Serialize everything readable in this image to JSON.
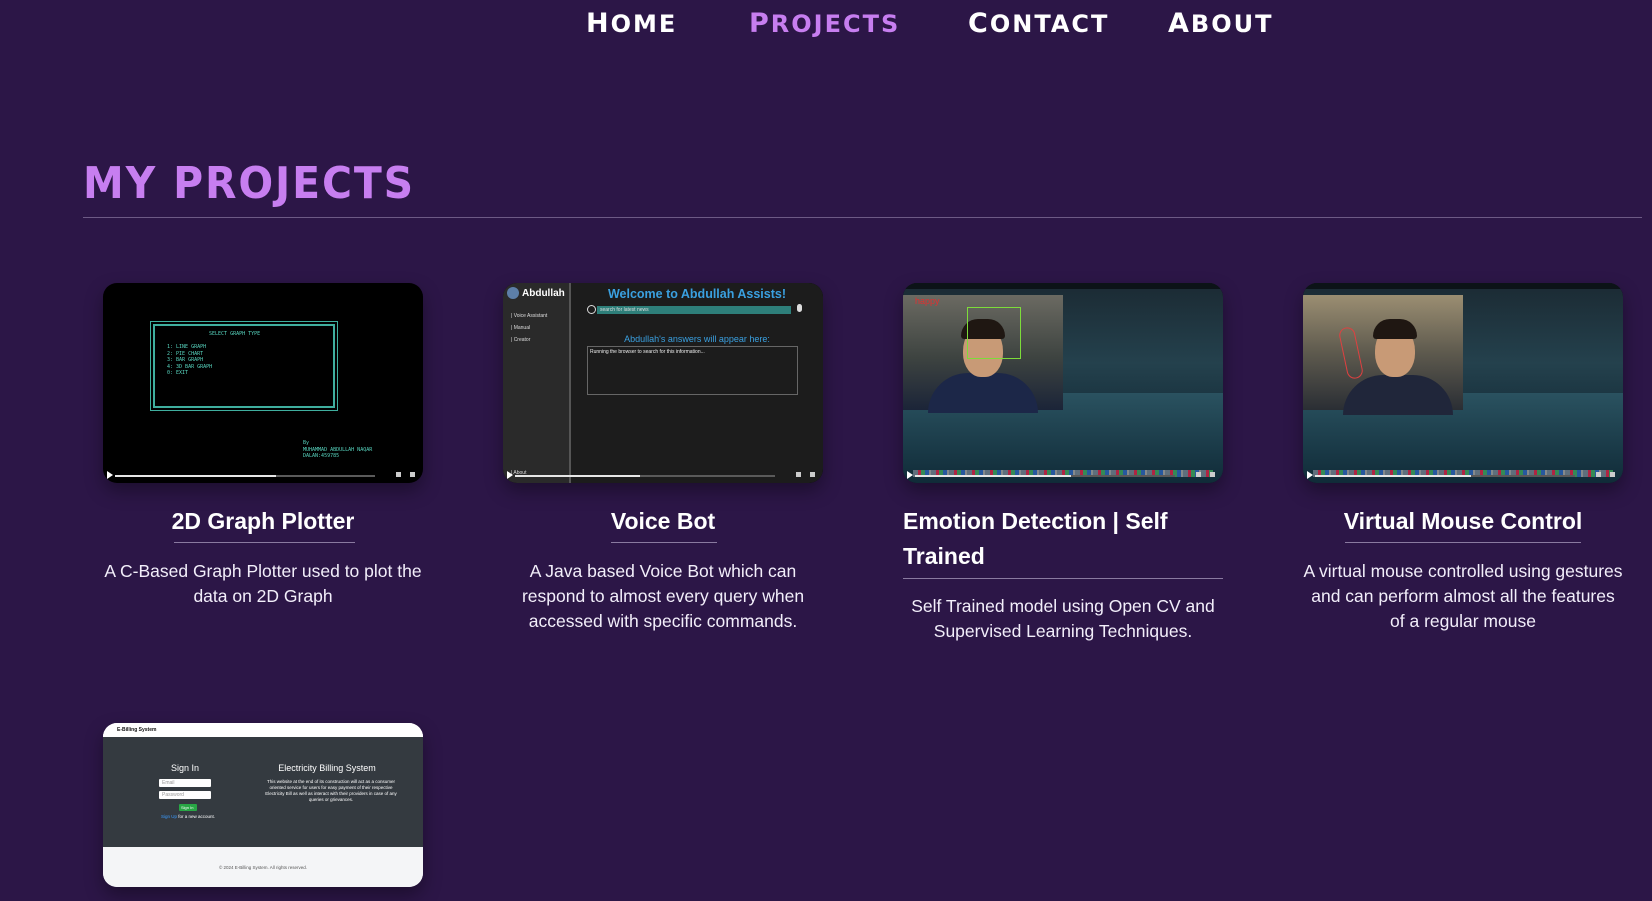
{
  "nav": {
    "items": [
      {
        "first": "H",
        "rest": "OME",
        "active": false
      },
      {
        "first": "P",
        "rest": "ROJECTS",
        "active": true
      },
      {
        "first": "C",
        "rest": "ONTACT",
        "active": false
      },
      {
        "first": "A",
        "rest": "BOUT",
        "active": false
      }
    ]
  },
  "page": {
    "title": "MY PROJECTS"
  },
  "projects": [
    {
      "title": "2D Graph Plotter",
      "description": "A C-Based Graph Plotter used to plot the data on 2D Graph",
      "thumb": {
        "heading": "SELECT GRAPH TYPE",
        "menu": "1: LINE GRAPH\n2: PIE CHART\n3: BAR GRAPH\n4: 3D BAR GRAPH\n0: EXIT",
        "credit": "By\nMUHAMMAD ABDULLAH NAQAR\nDALAN:459785",
        "progress": 0.62
      }
    },
    {
      "title": "Voice Bot",
      "description": "A Java based Voice Bot which can respond to almost every query when accessed with specific commands.",
      "thumb": {
        "brand": "Abdullah",
        "welcome": "Welcome to Abdullah Assists!",
        "search_value": "search for latest news",
        "answers_label": "Abdullah's answers will appear here:",
        "answer_text": "Running the browser to search for this information...",
        "menu": [
          "| Voice Assistant",
          "| Manual",
          "| Creator"
        ],
        "footer": "| About",
        "progress": 0.48
      }
    },
    {
      "title": "Emotion Detection | Self Trained",
      "description": "Self Trained model using Open CV and Supervised Learning Techniques.",
      "thumb": {
        "label": "happy",
        "progress": 0.6
      }
    },
    {
      "title": "Virtual Mouse Control",
      "description": "A virtual mouse controlled using gestures and can perform almost all the features of a regular mouse",
      "thumb": {
        "progress": 0.6
      }
    },
    {
      "title": "",
      "description": "",
      "thumb": {
        "app": "E-Billing System",
        "signin": "Sign In",
        "email_ph": "Email",
        "password_ph": "Password",
        "signin_btn": "Sign In",
        "signup_link": "Sign Up",
        "signup_rest": " for a new account.",
        "heading": "Electricity Billing System",
        "about": "This website at the end of its construction will act as a consumer oriented service for users for easy payment of their respective Electricity Bill as well as interact with their providers in case of any queries or grievances.",
        "footer": "© 2024 E-Billing System. All rights reserved."
      }
    }
  ],
  "colors": {
    "background": "#2c1647",
    "accent": "#c77ef0",
    "text": "#ffffff"
  }
}
